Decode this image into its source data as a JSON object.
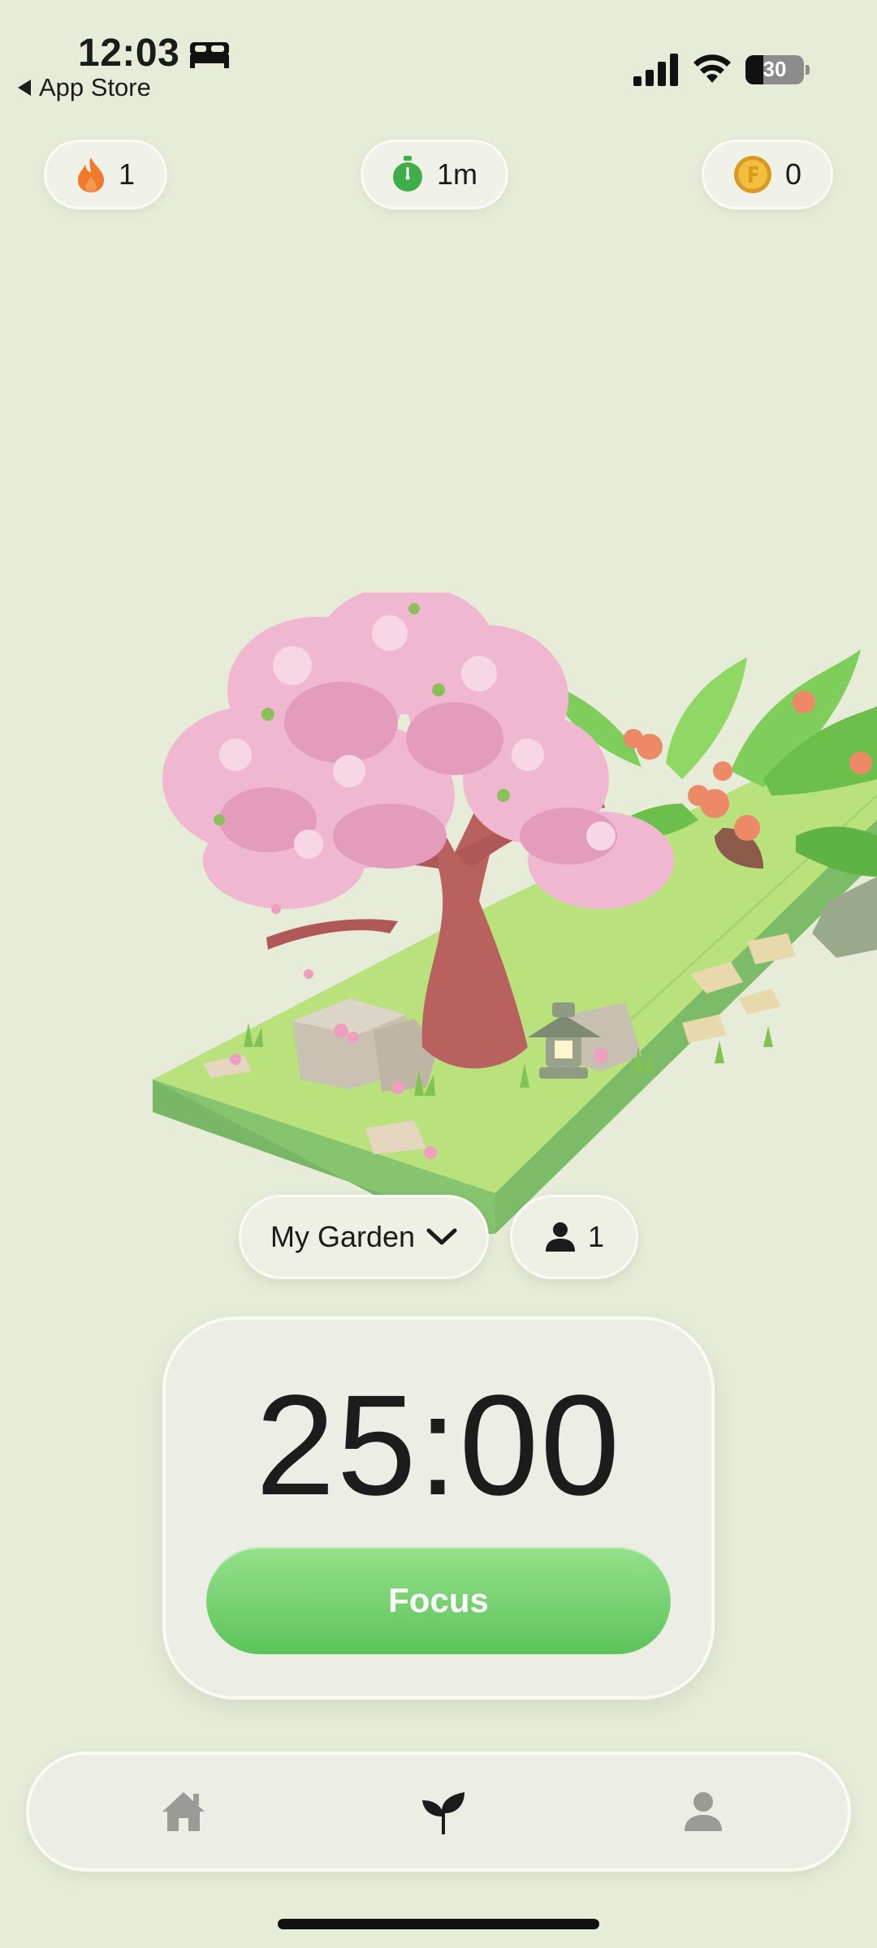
{
  "status_bar": {
    "time": "12:03",
    "back_label": "App Store",
    "battery": "30"
  },
  "top_bar": {
    "streak": "1",
    "timer": "1m",
    "coins": "0"
  },
  "garden_selector": {
    "name": "My Garden",
    "members": "1"
  },
  "timer": {
    "display": "25:00",
    "button_label": "Focus"
  },
  "tab_bar": {
    "items": [
      "home-icon",
      "sprout-icon",
      "person-icon"
    ],
    "active": "sprout-icon"
  },
  "colors": {
    "background": "#e6ecd7",
    "accent_green": "#5cc45a",
    "flame": "#f07a2a",
    "coin": "#e9b431"
  }
}
